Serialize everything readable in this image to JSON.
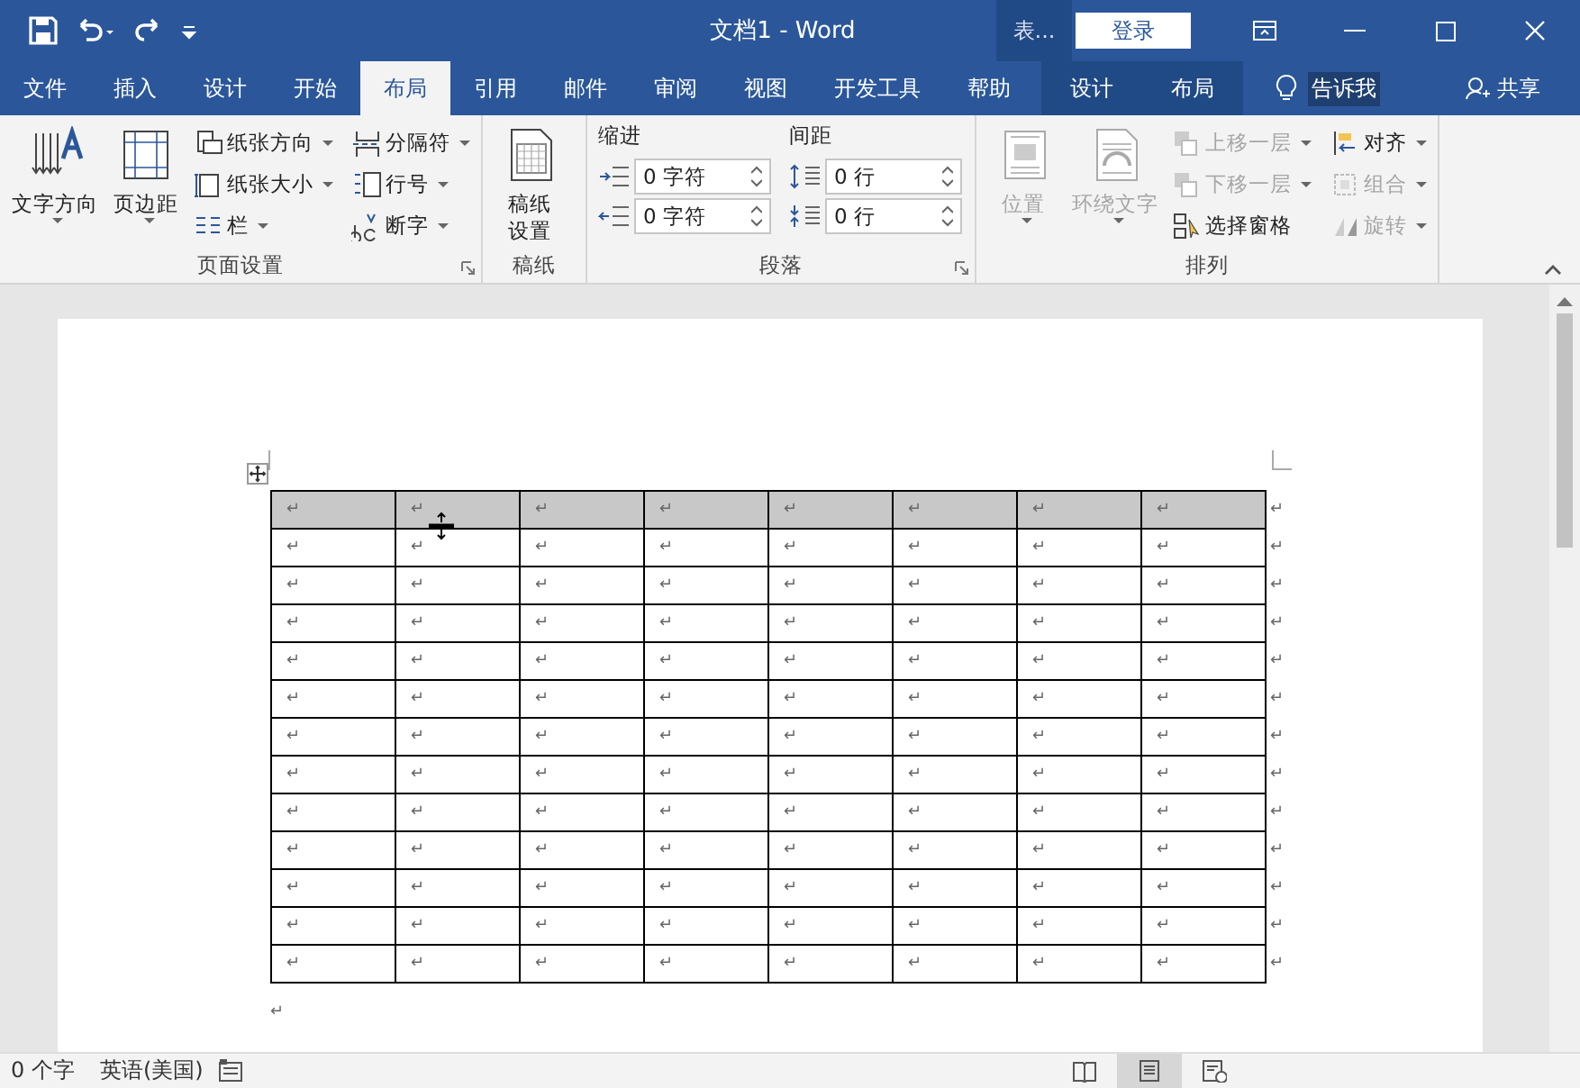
{
  "title_bar": {
    "title": "文档1 - Word",
    "context_label": "表...",
    "sign_in": "登录"
  },
  "tabs": [
    {
      "label": "文件",
      "selected": false
    },
    {
      "label": "插入",
      "selected": false
    },
    {
      "label": "设计",
      "selected": false
    },
    {
      "label": "开始",
      "selected": false
    },
    {
      "label": "布局",
      "selected": true
    },
    {
      "label": "引用",
      "selected": false
    },
    {
      "label": "邮件",
      "selected": false
    },
    {
      "label": "审阅",
      "selected": false
    },
    {
      "label": "视图",
      "selected": false
    },
    {
      "label": "开发工具",
      "selected": false
    },
    {
      "label": "帮助",
      "selected": false
    }
  ],
  "context_tabs": [
    {
      "label": "设计",
      "selected": false
    },
    {
      "label": "布局",
      "selected": false
    }
  ],
  "tell_me": "告诉我",
  "share": "共享",
  "ribbon": {
    "groups": [
      {
        "kind": "buttons",
        "label": "页面设置",
        "launcher": true,
        "items": [
          {
            "kind": "large",
            "label": "文字方向",
            "dropdown": true,
            "disabled": false
          },
          {
            "kind": "large",
            "label": "页边距",
            "dropdown": true,
            "disabled": false
          },
          {
            "kind": "small",
            "label": "纸张方向",
            "dropdown": true,
            "disabled": false
          },
          {
            "kind": "small",
            "label": "纸张大小",
            "dropdown": true,
            "disabled": false
          },
          {
            "kind": "small",
            "label": "栏",
            "dropdown": true,
            "disabled": false
          },
          {
            "kind": "small",
            "label": "分隔符",
            "dropdown": true,
            "disabled": false
          },
          {
            "kind": "small",
            "label": "行号",
            "dropdown": true,
            "disabled": false
          },
          {
            "kind": "small",
            "label": "断字",
            "dropdown": true,
            "disabled": false
          }
        ]
      },
      {
        "kind": "buttons",
        "label": "稿纸",
        "launcher": false,
        "items": [
          {
            "kind": "large",
            "label": "稿纸设置",
            "dropdown": false,
            "disabled": false
          }
        ]
      },
      {
        "kind": "spacing",
        "label": "段落",
        "launcher": true,
        "columns": [
          {
            "label": "缩进",
            "fields": [
              "0 字符",
              "0 字符"
            ]
          },
          {
            "label": "间距",
            "fields": [
              "0 行",
              "0 行"
            ]
          }
        ]
      },
      {
        "kind": "buttons",
        "label": "排列",
        "launcher": false,
        "items": [
          {
            "kind": "large",
            "label": "位置",
            "dropdown": true,
            "disabled": true
          },
          {
            "kind": "large",
            "label": "环绕文字",
            "dropdown": true,
            "disabled": true
          },
          {
            "kind": "small",
            "label": "上移一层",
            "dropdown": true,
            "disabled": true
          },
          {
            "kind": "small",
            "label": "下移一层",
            "dropdown": true,
            "disabled": true
          },
          {
            "kind": "small",
            "label": "选择窗格",
            "dropdown": false,
            "disabled": false
          },
          {
            "kind": "small",
            "label": "对齐",
            "dropdown": true,
            "disabled": false
          },
          {
            "kind": "small",
            "label": "组合",
            "dropdown": true,
            "disabled": true
          },
          {
            "kind": "small",
            "label": "旋转",
            "dropdown": true,
            "disabled": true
          }
        ]
      }
    ]
  },
  "document": {
    "table": {
      "rows": [
        {
          "selected": true,
          "cells": [
            "↵",
            "↵",
            "↵",
            "↵",
            "↵",
            "↵",
            "↵",
            "↵"
          ],
          "end_mark": "↵"
        },
        {
          "selected": false,
          "cells": [
            "↵",
            "↵",
            "↵",
            "↵",
            "↵",
            "↵",
            "↵",
            "↵"
          ],
          "end_mark": "↵"
        },
        {
          "selected": false,
          "cells": [
            "↵",
            "↵",
            "↵",
            "↵",
            "↵",
            "↵",
            "↵",
            "↵"
          ],
          "end_mark": "↵"
        },
        {
          "selected": false,
          "cells": [
            "↵",
            "↵",
            "↵",
            "↵",
            "↵",
            "↵",
            "↵",
            "↵"
          ],
          "end_mark": "↵"
        },
        {
          "selected": false,
          "cells": [
            "↵",
            "↵",
            "↵",
            "↵",
            "↵",
            "↵",
            "↵",
            "↵"
          ],
          "end_mark": "↵"
        },
        {
          "selected": false,
          "cells": [
            "↵",
            "↵",
            "↵",
            "↵",
            "↵",
            "↵",
            "↵",
            "↵"
          ],
          "end_mark": "↵"
        },
        {
          "selected": false,
          "cells": [
            "↵",
            "↵",
            "↵",
            "↵",
            "↵",
            "↵",
            "↵",
            "↵"
          ],
          "end_mark": "↵"
        },
        {
          "selected": false,
          "cells": [
            "↵",
            "↵",
            "↵",
            "↵",
            "↵",
            "↵",
            "↵",
            "↵"
          ],
          "end_mark": "↵"
        },
        {
          "selected": false,
          "cells": [
            "↵",
            "↵",
            "↵",
            "↵",
            "↵",
            "↵",
            "↵",
            "↵"
          ],
          "end_mark": "↵"
        },
        {
          "selected": false,
          "cells": [
            "↵",
            "↵",
            "↵",
            "↵",
            "↵",
            "↵",
            "↵",
            "↵"
          ],
          "end_mark": "↵"
        },
        {
          "selected": false,
          "cells": [
            "↵",
            "↵",
            "↵",
            "↵",
            "↵",
            "↵",
            "↵",
            "↵"
          ],
          "end_mark": "↵"
        },
        {
          "selected": false,
          "cells": [
            "↵",
            "↵",
            "↵",
            "↵",
            "↵",
            "↵",
            "↵",
            "↵"
          ],
          "end_mark": "↵"
        },
        {
          "selected": false,
          "cells": [
            "↵",
            "↵",
            "↵",
            "↵",
            "↵",
            "↵",
            "↵",
            "↵"
          ],
          "end_mark": "↵"
        }
      ]
    },
    "after_table": "↵"
  },
  "status_bar": {
    "word_count": "0 个字",
    "language": "英语(美国)",
    "views": [
      {
        "selected": false
      },
      {
        "selected": true
      },
      {
        "selected": false
      }
    ]
  }
}
